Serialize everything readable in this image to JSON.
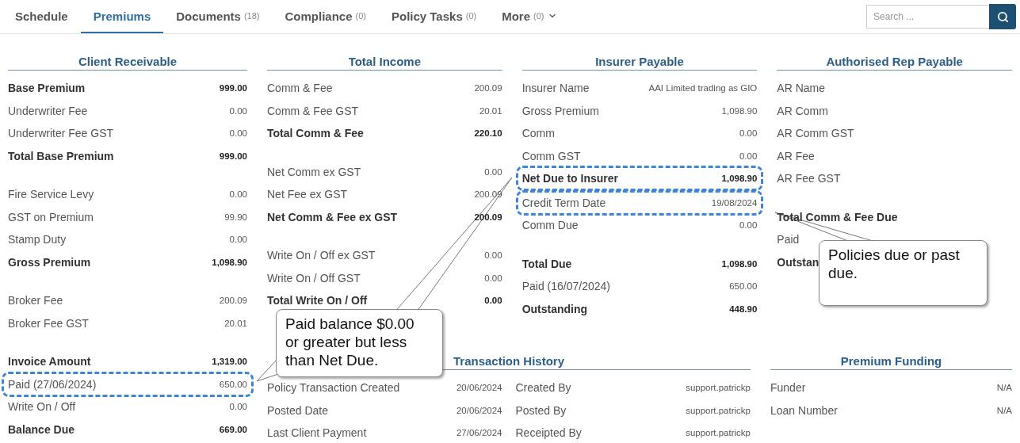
{
  "tabs": [
    {
      "label": "Schedule",
      "selected": false
    },
    {
      "label": "Premiums",
      "selected": true
    },
    {
      "label": "Documents",
      "count": "(18)",
      "selected": false
    },
    {
      "label": "Compliance",
      "count": "(0)",
      "selected": false
    },
    {
      "label": "Policy Tasks",
      "count": "(0)",
      "selected": false
    },
    {
      "label": "More",
      "count": "(0)",
      "selected": false,
      "has_menu": true
    }
  ],
  "search": {
    "placeholder": "Search ..."
  },
  "client_receivable": {
    "title": "Client Receivable",
    "groups": [
      [
        {
          "label": "Base Premium",
          "value": "999.00",
          "bold": true,
          "highlighted": false
        },
        {
          "label": "Underwriter Fee",
          "value": "0.00",
          "bold": false,
          "highlighted": false
        },
        {
          "label": "Underwriter Fee GST",
          "value": "0.00",
          "bold": false,
          "highlighted": false
        },
        {
          "label": "Total Base Premium",
          "value": "999.00",
          "bold": true,
          "highlighted": false
        }
      ],
      [
        {
          "label": "Fire Service Levy",
          "value": "0.00",
          "bold": false,
          "highlighted": false
        },
        {
          "label": "GST on Premium",
          "value": "99.90",
          "bold": false,
          "highlighted": false
        },
        {
          "label": "Stamp Duty",
          "value": "0.00",
          "bold": false,
          "highlighted": false
        },
        {
          "label": "Gross Premium",
          "value": "1,098.90",
          "bold": true,
          "highlighted": false
        }
      ],
      [
        {
          "label": "Broker Fee",
          "value": "200.09",
          "bold": false,
          "highlighted": false
        },
        {
          "label": "Broker Fee GST",
          "value": "20.01",
          "bold": false,
          "highlighted": false
        }
      ],
      [
        {
          "label": "Invoice Amount",
          "value": "1,319.00",
          "bold": true,
          "highlighted": false
        },
        {
          "label": "Paid (27/06/2024)",
          "value": "650.00",
          "bold": false,
          "highlighted": true
        },
        {
          "label": "Write On / Off",
          "value": "0.00",
          "bold": false,
          "highlighted": false
        },
        {
          "label": "Balance Due",
          "value": "669.00",
          "bold": true,
          "highlighted": false
        }
      ]
    ]
  },
  "sections": [
    {
      "title": "Total Income",
      "groups": [
        [
          {
            "label": "Comm & Fee",
            "value": "200.09",
            "bold": false,
            "highlighted": false
          },
          {
            "label": "Comm & Fee GST",
            "value": "20.01",
            "bold": false,
            "highlighted": false
          },
          {
            "label": "Total Comm & Fee",
            "value": "220.10",
            "bold": true,
            "highlighted": false
          }
        ],
        [
          {
            "label": "Net Comm ex GST",
            "value": "0.00",
            "bold": false,
            "highlighted": false
          },
          {
            "label": "Net Fee ex GST",
            "value": "200.09",
            "bold": false,
            "highlighted": false
          },
          {
            "label": "Net Comm & Fee ex GST",
            "value": "200.09",
            "bold": true,
            "highlighted": false
          }
        ],
        [
          {
            "label": "Write On / Off ex GST",
            "value": "0.00",
            "bold": false,
            "highlighted": false
          },
          {
            "label": "Write On / Off GST",
            "value": "0.00",
            "bold": false,
            "highlighted": false
          },
          {
            "label": "Total Write On / Off",
            "value": "0.00",
            "bold": true,
            "highlighted": false
          }
        ]
      ]
    },
    {
      "title": "Insurer Payable",
      "groups": [
        [
          {
            "label": "Insurer Name",
            "value": "AAI Limited trading as GIO",
            "bold": false,
            "highlighted": false
          },
          {
            "label": "Gross Premium",
            "value": "1,098.90",
            "bold": false,
            "highlighted": false
          },
          {
            "label": "Comm",
            "value": "0.00",
            "bold": false,
            "highlighted": false
          },
          {
            "label": "Comm GST",
            "value": "0.00",
            "bold": false,
            "highlighted": false
          },
          {
            "label": "Net Due to Insurer",
            "value": "1,098.90",
            "bold": true,
            "highlighted": true
          },
          {
            "label": "Credit Term Date",
            "value": "19/08/2024",
            "bold": false,
            "highlighted": true
          },
          {
            "label": "Comm Due",
            "value": "0.00",
            "bold": false,
            "highlighted": false
          }
        ],
        [
          {
            "label": "Total Due",
            "value": "1,098.90",
            "bold": true,
            "highlighted": false
          },
          {
            "label": "Paid (16/07/2024)",
            "value": "650.00",
            "bold": false,
            "highlighted": false
          },
          {
            "label": "Outstanding",
            "value": "448.90",
            "bold": true,
            "highlighted": false
          }
        ]
      ]
    },
    {
      "title": "Authorised Rep Payable",
      "groups": [
        [
          {
            "label": "AR Name",
            "bold": false,
            "highlighted": false
          },
          {
            "label": "AR Comm",
            "bold": false,
            "highlighted": false
          },
          {
            "label": "AR Comm GST",
            "bold": false,
            "highlighted": false
          },
          {
            "label": "AR Fee",
            "bold": false,
            "highlighted": false
          },
          {
            "label": "AR Fee GST",
            "bold": false,
            "highlighted": false
          }
        ],
        [
          {
            "label": "Total Comm & Fee Due",
            "bold": true,
            "highlighted": false
          },
          {
            "label": "Paid",
            "bold": false,
            "highlighted": false
          },
          {
            "label": "Outstan",
            "bold": true,
            "highlighted": false
          }
        ]
      ]
    }
  ],
  "transaction_history": {
    "title": "Transaction History",
    "rows": [
      [
        {
          "label": "Policy Transaction Created",
          "value": "20/06/2024"
        },
        {
          "label": "Created By",
          "value": "support.patrickp"
        }
      ],
      [
        {
          "label": "Posted Date",
          "value": "20/06/2024"
        },
        {
          "label": "Posted By",
          "value": "support.patrickp"
        }
      ],
      [
        {
          "label": "Last Client Payment",
          "value": "27/06/2024"
        },
        {
          "label": "Receipted By",
          "value": "support.patrickp"
        }
      ]
    ]
  },
  "premium_funding": {
    "title": "Premium Funding",
    "rows": [
      {
        "label": "Funder",
        "value": "N/A"
      },
      {
        "label": "Loan Number",
        "value": "N/A"
      }
    ]
  },
  "callouts": [
    {
      "text": "Paid balance $0.00\nor greater but less\nthan Net Due."
    },
    {
      "text": "Policies due or past\ndue."
    }
  ]
}
